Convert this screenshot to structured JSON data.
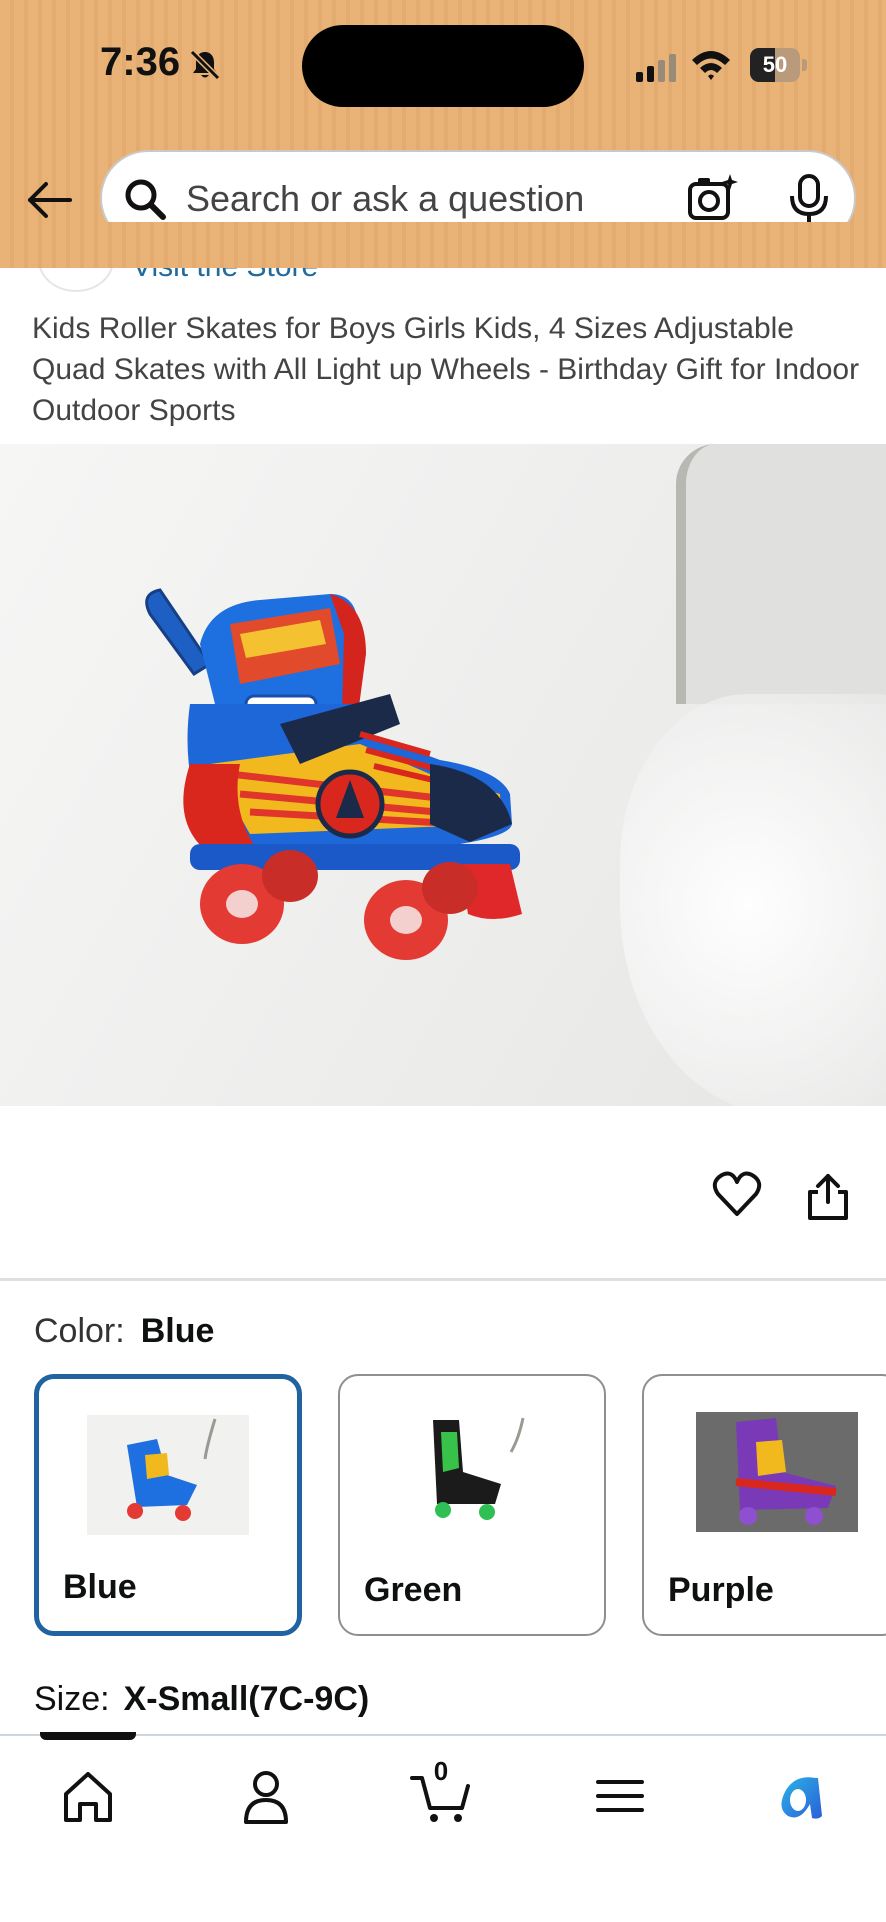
{
  "status_bar": {
    "time": "7:36",
    "battery": "50",
    "battery_level": 0.5
  },
  "search": {
    "placeholder": "Search or ask a question"
  },
  "store": {
    "link_text": "Visit the Store"
  },
  "product": {
    "title": "Kids Roller Skates for Boys Girls Kids, 4 Sizes Adjustable Quad Skates with All Light up Wheels - Birthday Gift for Indoor Outdoor Sports"
  },
  "color": {
    "label": "Color:",
    "selected": "Blue",
    "options": [
      {
        "label": "Blue",
        "selected": true
      },
      {
        "label": "Green",
        "selected": false
      },
      {
        "label": "Purple",
        "selected": false
      }
    ]
  },
  "size": {
    "label": "Size:",
    "selected": "X-Small(7C-9C)"
  },
  "bottom_nav": {
    "cart_count": "0",
    "items": [
      "home-icon",
      "profile-icon",
      "cart-icon",
      "menu-icon",
      "rufus-icon"
    ]
  },
  "colors": {
    "header_bg": "#e9b378",
    "link": "#1f6a9e",
    "selected_border": "#2162a1"
  }
}
